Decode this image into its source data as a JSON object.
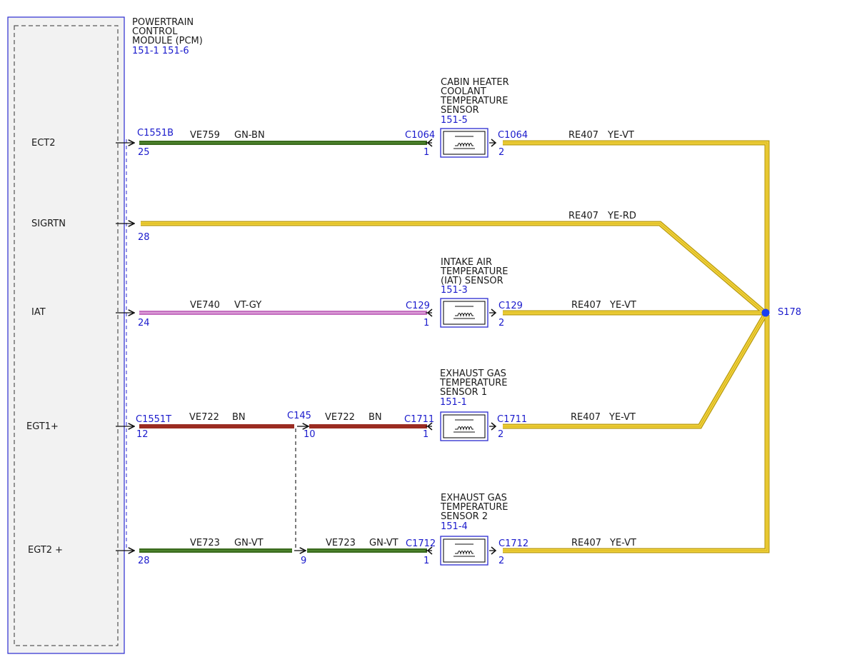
{
  "colors": {
    "module_border": "#2a2ad0",
    "module_fill": "#f2f2f2",
    "wire_gn_bn": "#3b6b1e",
    "wire_gn_vt": "#3b6b1e",
    "wire_vt_gy": "#c46fc0",
    "wire_bn": "#9b2c22",
    "wire_ye": "#f1d33a",
    "wire_ye_edge": "#b89a12",
    "splice": "#1a3ef0",
    "label_blue": "#1a1acc"
  },
  "module": {
    "title_lines": [
      "POWERTRAIN",
      "CONTROL",
      "MODULE (PCM)"
    ],
    "refs": "151-1 151-6",
    "pins": [
      "ECT2",
      "SIGRTN",
      "IAT",
      "EGT1+",
      "EGT2 +"
    ]
  },
  "connectors": {
    "c1551b": "C1551B",
    "c1551t": "C1551T",
    "c145": "C145"
  },
  "rows": {
    "ect2": {
      "pcm_pin": "25",
      "circuit": "VE759",
      "color": "GN-BN",
      "conn": "C1064",
      "pin_in": "1",
      "pin_out": "2",
      "ret_circuit": "RE407",
      "ret_color": "YE-VT"
    },
    "sigrtn": {
      "pcm_pin": "28",
      "circuit": "RE407",
      "color": "YE-RD"
    },
    "iat": {
      "pcm_pin": "24",
      "circuit": "VE740",
      "color": "VT-GY",
      "conn": "C129",
      "pin_in": "1",
      "pin_out": "2",
      "ret_circuit": "RE407",
      "ret_color": "YE-VT"
    },
    "egt1": {
      "pcm_pin": "12",
      "circuit": "VE722",
      "color": "BN",
      "inline_pin": "10",
      "circuit2": "VE722",
      "color2": "BN",
      "conn": "C1711",
      "pin_in": "1",
      "pin_out": "2",
      "ret_circuit": "RE407",
      "ret_color": "YE-VT"
    },
    "egt2": {
      "pcm_pin": "28",
      "circuit": "VE723",
      "color": "GN-VT",
      "inline_pin": "9",
      "circuit2": "VE723",
      "color2": "GN-VT",
      "conn": "C1712",
      "pin_in": "1",
      "pin_out": "2",
      "ret_circuit": "RE407",
      "ret_color": "YE-VT"
    }
  },
  "components": {
    "cabin": {
      "name_lines": [
        "CABIN HEATER",
        "COOLANT",
        "TEMPERATURE",
        "SENSOR"
      ],
      "ref": "151-5"
    },
    "iat": {
      "name_lines": [
        "INTAKE AIR",
        "TEMPERATURE",
        "(IAT) SENSOR"
      ],
      "ref": "151-3"
    },
    "egt1": {
      "name_lines": [
        "EXHAUST GAS",
        "TEMPERATURE",
        "SENSOR 1"
      ],
      "ref": "151-1"
    },
    "egt2": {
      "name_lines": [
        "EXHAUST GAS",
        "TEMPERATURE",
        "SENSOR 2"
      ],
      "ref": "151-4"
    }
  },
  "splice": {
    "label": "S178"
  }
}
